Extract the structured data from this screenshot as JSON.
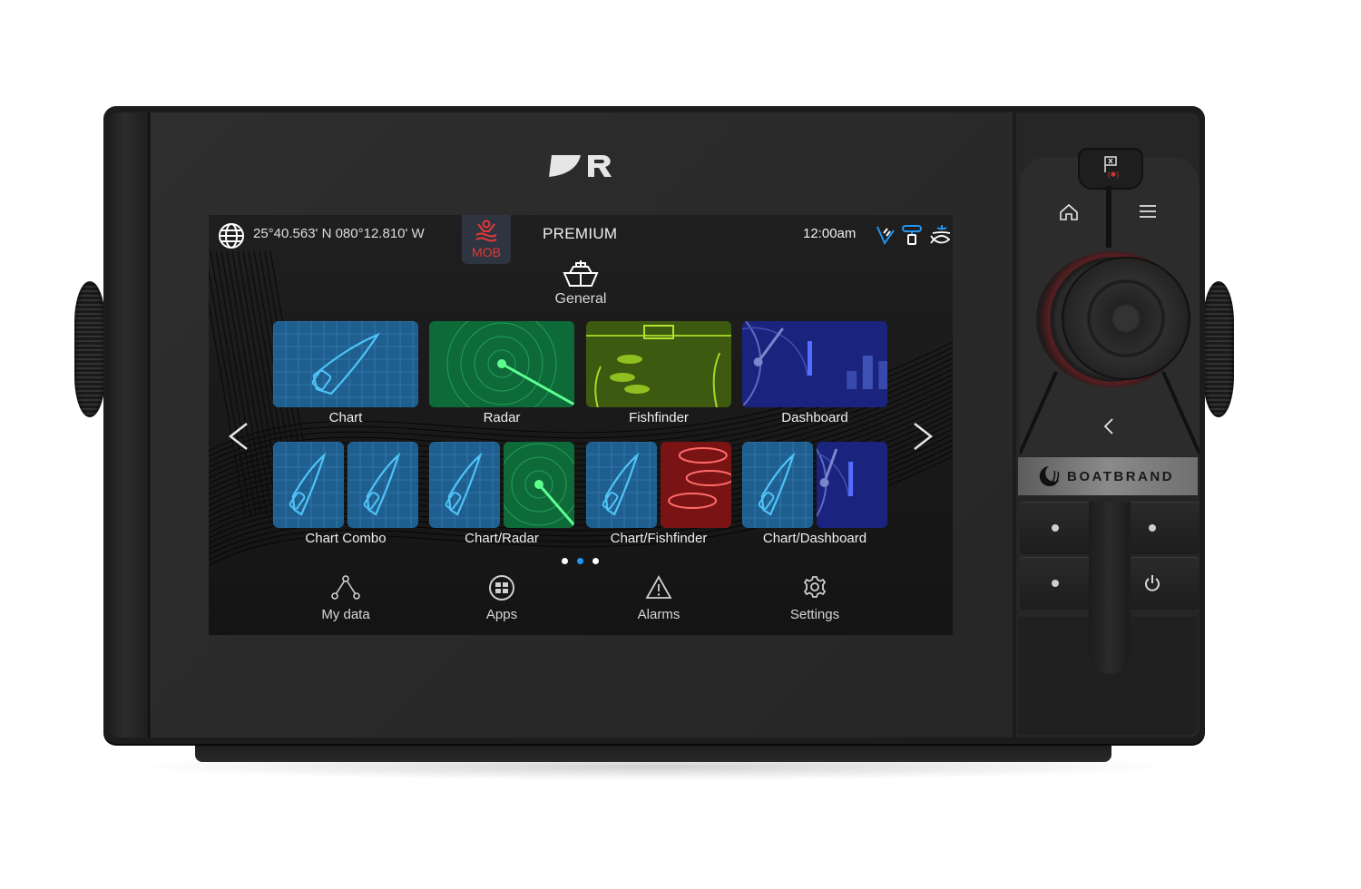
{
  "device": {
    "manufacturer_logo": "raymarine-r-logo",
    "brand_plate": "BOATBRAND"
  },
  "status_bar": {
    "position": "25°40.563' N  080°12.810' W",
    "mob_label": "MOB",
    "mode_label": "PREMIUM",
    "time": "12:00am",
    "status_icons": [
      "autopilot-icon",
      "transducer-icon",
      "fish-sonar-icon"
    ]
  },
  "profile": {
    "icon": "boat-icon",
    "label": "General"
  },
  "pager": {
    "pages": 3,
    "active_page": 2
  },
  "apps": [
    {
      "label": "Chart",
      "kind": "chart"
    },
    {
      "label": "Radar",
      "kind": "radar"
    },
    {
      "label": "Fishfinder",
      "kind": "fishfinder"
    },
    {
      "label": "Dashboard",
      "kind": "dashboard"
    },
    {
      "label": "Chart Combo",
      "kind": "chart+chart"
    },
    {
      "label": "Chart/Radar",
      "kind": "chart+radar"
    },
    {
      "label": "Chart/Fishfinder",
      "kind": "chart+fishfinder"
    },
    {
      "label": "Chart/Dashboard",
      "kind": "chart+dashboard"
    }
  ],
  "bottom_nav": [
    {
      "label": "My data",
      "icon": "waypoints-icon"
    },
    {
      "label": "Apps",
      "icon": "apps-grid-icon"
    },
    {
      "label": "Alarms",
      "icon": "warning-icon"
    },
    {
      "label": "Settings",
      "icon": "gear-icon"
    }
  ],
  "keypad": {
    "buttons": [
      "waypoint-mob",
      "home",
      "menu",
      "joystick",
      "back",
      "user-1",
      "user-2",
      "user-3",
      "power"
    ]
  },
  "colors": {
    "chart_blue": "#1f5f8f",
    "radar_green": "#0f6a3a",
    "fish_green": "#3d5a10",
    "dash_blue": "#1a237e",
    "fish_red": "#7a1414",
    "mob_red": "#e53935",
    "accent_blue": "#2196f3"
  }
}
